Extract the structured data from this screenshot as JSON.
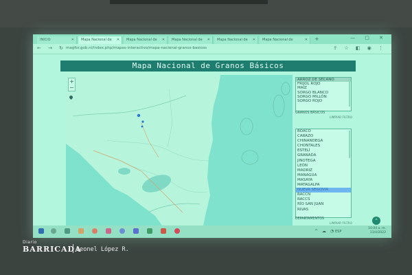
{
  "browser": {
    "tabs": [
      {
        "label": "INICIO"
      },
      {
        "label": "Mapa Nacional de"
      },
      {
        "label": "Mapa Nacional de"
      },
      {
        "label": "Mapa Nacional de"
      },
      {
        "label": "Mapa Nacional de"
      },
      {
        "label": "Mapa Nacional de"
      }
    ],
    "new_tab": "+",
    "window_controls": "— ▢ ✕",
    "nav": "← → ↻",
    "url": "magfor.gob.ni/index.php/mapas-interactivo/mapa-nacional-granos-basicos",
    "addr_icons": "⇪ ☆ ◧ ◉ ⋮"
  },
  "page": {
    "title": "Mapa Nacional de Granos Básicos",
    "map": {
      "zoom_in": "+",
      "zoom_out": "−"
    },
    "grains": {
      "items": [
        "ARROZ DE SECANO",
        "FRIJOL ROJO",
        "MAÍZ",
        "SORGO BLANCO",
        "SORGO MILLÓN",
        "SORGO ROJO"
      ],
      "selected_index": 0,
      "label": "GRANOS BÁSICOS",
      "clear": "LIMPIAR FILTRO"
    },
    "departments": {
      "items": [
        "BOACO",
        "CARAZO",
        "CHINANDEGA",
        "CHONTALES",
        "ESTELÍ",
        "GRANADA",
        "JINOTEGA",
        "LEÓN",
        "MADRIZ",
        "MANAGUA",
        "MASAYA",
        "MATAGALPA",
        "NUEVA SEGOVIA",
        "RACCN",
        "RACCS",
        "RÍO SAN JUAN",
        "RIVAS"
      ],
      "selected_index": 12,
      "label": "DEPARTAMENTOS",
      "clear": "LIMPIAR FILTRO"
    },
    "fab": "⌃"
  },
  "taskbar": {
    "lang": "ESP",
    "time": "10:04 a. m.",
    "date": "13/4/2022",
    "sys": "^ ☁ ◔"
  },
  "watermark": {
    "small": "Diario",
    "brand": "BARRICADA",
    "author": "Leonel López R."
  },
  "colors": {
    "screen": "#a6f2d4",
    "title_bar": "#1f7d70",
    "selected_dept": "#6fb6f0"
  }
}
